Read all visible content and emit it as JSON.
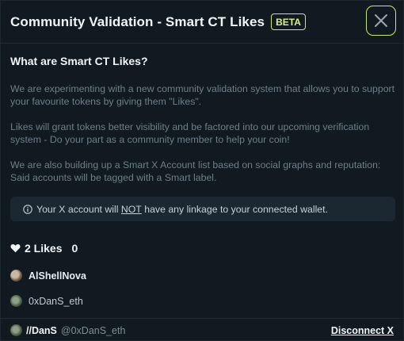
{
  "modal": {
    "title": "Community Validation - Smart CT Likes",
    "badge": "BETA",
    "close_icon": "close-icon"
  },
  "content": {
    "heading": "What are Smart CT Likes?",
    "paragraphs": [
      "We are experimenting with a new community validation system that allows you to support your favourite tokens by giving them \"Likes\".",
      "Likes will grant tokens better visibility and be factored into our upcoming verification system - Do your part as a community member to help your coin!",
      "We are also building up a Smart X Account list based on social graphs and reputation: Said accounts will be tagged with a Smart label."
    ],
    "notice": {
      "icon": "info-icon",
      "prefix": "Your X account will ",
      "emphasis": "NOT",
      "suffix": " have any linkage to your connected wallet."
    }
  },
  "likes": {
    "icon": "heart-icon",
    "label": "2 Likes",
    "secondary_count": "0",
    "users": [
      {
        "name": "AlShellNova"
      },
      {
        "name": "0xDanS_eth"
      }
    ]
  },
  "footer": {
    "display_name": "//DanS",
    "handle": "@0xDanS_eth",
    "disconnect_label": "Disconnect X"
  },
  "colors": {
    "accent": "#c7ea73",
    "background": "#101a20",
    "notice_bg": "#1b2731",
    "muted_text": "#6e7f8a"
  }
}
